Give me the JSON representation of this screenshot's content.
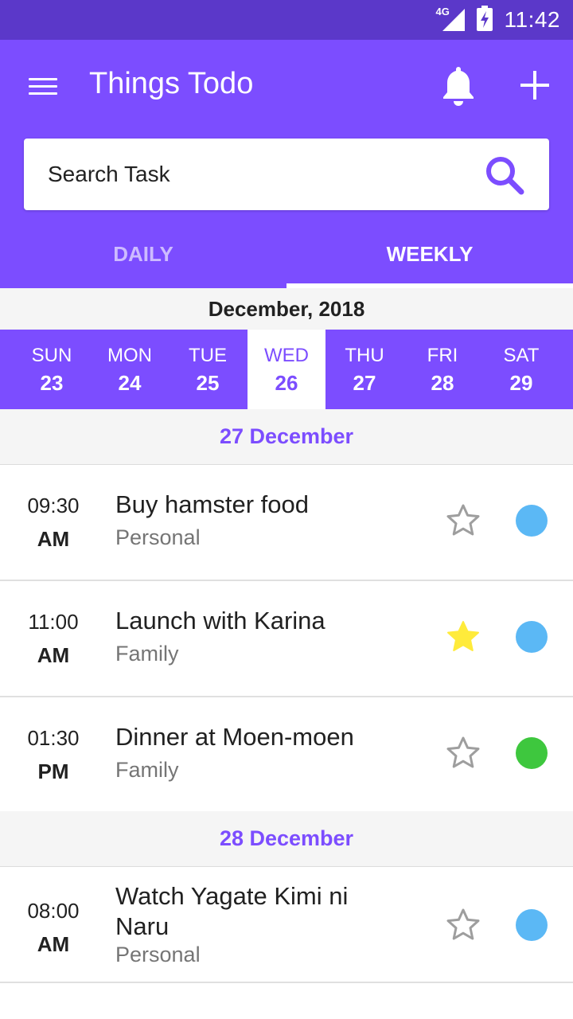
{
  "status_bar": {
    "network": "4G",
    "time": "11:42"
  },
  "app": {
    "title": "Things Todo"
  },
  "search": {
    "placeholder": "Search Task"
  },
  "tabs": [
    {
      "label": "DAILY",
      "active": false
    },
    {
      "label": "WEEKLY",
      "active": true
    }
  ],
  "month": "December, 2018",
  "week": [
    {
      "name": "SUN",
      "date": "23",
      "selected": false
    },
    {
      "name": "MON",
      "date": "24",
      "selected": false
    },
    {
      "name": "TUE",
      "date": "25",
      "selected": false
    },
    {
      "name": "WED",
      "date": "26",
      "selected": true
    },
    {
      "name": "THU",
      "date": "27",
      "selected": false
    },
    {
      "name": "FRI",
      "date": "28",
      "selected": false
    },
    {
      "name": "SAT",
      "date": "29",
      "selected": false
    }
  ],
  "sections": [
    {
      "header": "27 December",
      "tasks": [
        {
          "time": "09:30",
          "ampm": "AM",
          "title": "Buy hamster food",
          "category": "Personal",
          "starred": false,
          "dot_color": "#5bb8f5"
        },
        {
          "time": "11:00",
          "ampm": "AM",
          "title": "Launch with Karina",
          "category": "Family",
          "starred": true,
          "dot_color": "#5bb8f5"
        },
        {
          "time": "01:30",
          "ampm": "PM",
          "title": "Dinner at Moen-moen",
          "category": "Family",
          "starred": false,
          "dot_color": "#3ec73e"
        }
      ]
    },
    {
      "header": "28 December",
      "tasks": [
        {
          "time": "08:00",
          "ampm": "AM",
          "title": "Watch Yagate Kimi ni Naru",
          "category": "Personal",
          "starred": false,
          "dot_color": "#5bb8f5"
        }
      ]
    }
  ],
  "colors": {
    "primary": "#7c4dff",
    "status_bar": "#5b38c9",
    "star_active": "#ffeb3b",
    "star_inactive": "#9e9e9e"
  },
  "icons": {
    "menu": "menu-icon",
    "bell": "bell-icon",
    "add": "plus-icon",
    "search": "search-icon",
    "star": "star-icon"
  }
}
